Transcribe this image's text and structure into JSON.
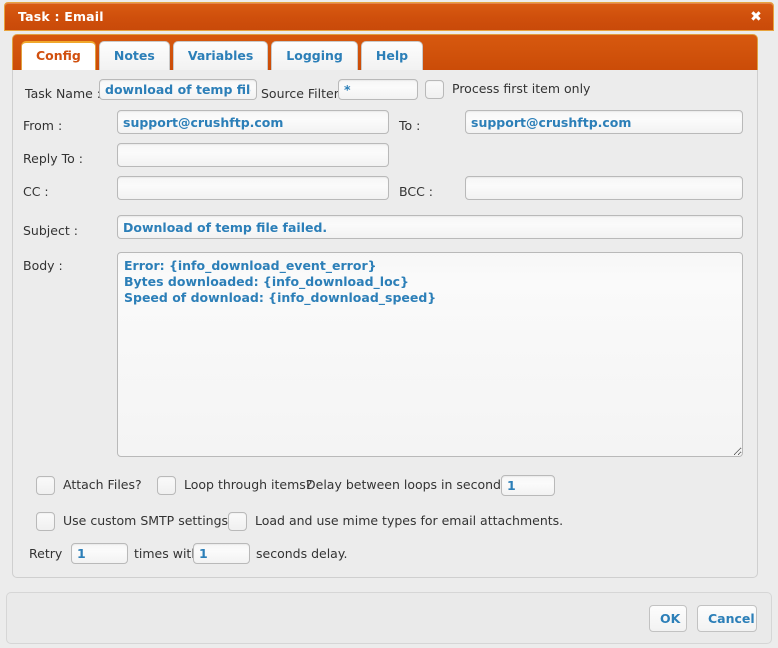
{
  "window": {
    "title": "Task : Email",
    "close_icon": "close-icon",
    "close_glyph": "✖"
  },
  "tabs": [
    {
      "label": "Config",
      "active": true
    },
    {
      "label": "Notes",
      "active": false
    },
    {
      "label": "Variables",
      "active": false
    },
    {
      "label": "Logging",
      "active": false
    },
    {
      "label": "Help",
      "active": false
    }
  ],
  "form": {
    "task_name_label": "Task Name :",
    "task_name_value": "download of temp file fail",
    "source_filter_label": "Source Filter :",
    "source_filter_value": "*",
    "process_first_item_label": "Process first item only",
    "from_label": "From :",
    "from_value": "support@crushftp.com",
    "to_label": "To :",
    "to_value": "support@crushftp.com",
    "reply_to_label": "Reply To :",
    "reply_to_value": "",
    "cc_label": "CC :",
    "cc_value": "",
    "bcc_label": "BCC :",
    "bcc_value": "",
    "subject_label": "Subject :",
    "subject_value": "Download of temp file failed.",
    "body_label": "Body :",
    "body_value": "Error: {info_download_event_error}\nBytes downloaded: {info_download_loc}\nSpeed of download: {info_download_speed}"
  },
  "options": {
    "attach_files_label": "Attach Files?",
    "loop_through_items_label": "Loop through items?",
    "delay_label": "Delay between loops in seconds :",
    "delay_value": "1",
    "use_custom_smtp_label": "Use custom SMTP settings",
    "load_mime_types_label": "Load and use mime types for email attachments.",
    "retry_prefix": "Retry",
    "retry_count_value": "1",
    "retry_middle": "times with",
    "retry_delay_value": "1",
    "retry_suffix": "seconds delay."
  },
  "footer": {
    "ok_label": "OK",
    "cancel_label": "Cancel"
  },
  "colors": {
    "titlebar": "#cf4f0c",
    "titlebar_border": "#e8a33d",
    "accent_blue": "#2c7fb8",
    "active_tab_text": "#d1500f",
    "panel_bg": "#ececec"
  }
}
